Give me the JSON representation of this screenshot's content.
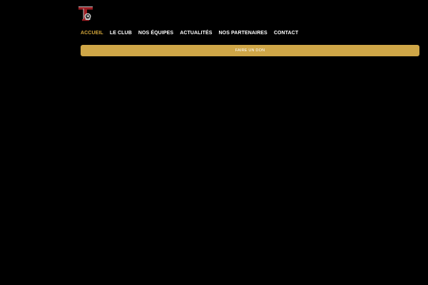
{
  "header": {
    "logo_icon": "club-crest-icon",
    "nav": {
      "items": [
        {
          "label": "ACCUEIL",
          "active": true
        },
        {
          "label": "LE CLUB",
          "active": false
        },
        {
          "label": "NOS ÉQUIPES",
          "active": false
        },
        {
          "label": "ACTUALITÉS",
          "active": false
        },
        {
          "label": "NOS PARTENAIRES",
          "active": false
        },
        {
          "label": "CONTACT",
          "active": false
        }
      ]
    },
    "donate_label": "FAIRE UN DON"
  },
  "colors": {
    "background": "#000000",
    "accent": "#d4a73a",
    "button": "#cfa647",
    "nav_text": "#ffffff",
    "logo_red": "#9b1c22"
  }
}
